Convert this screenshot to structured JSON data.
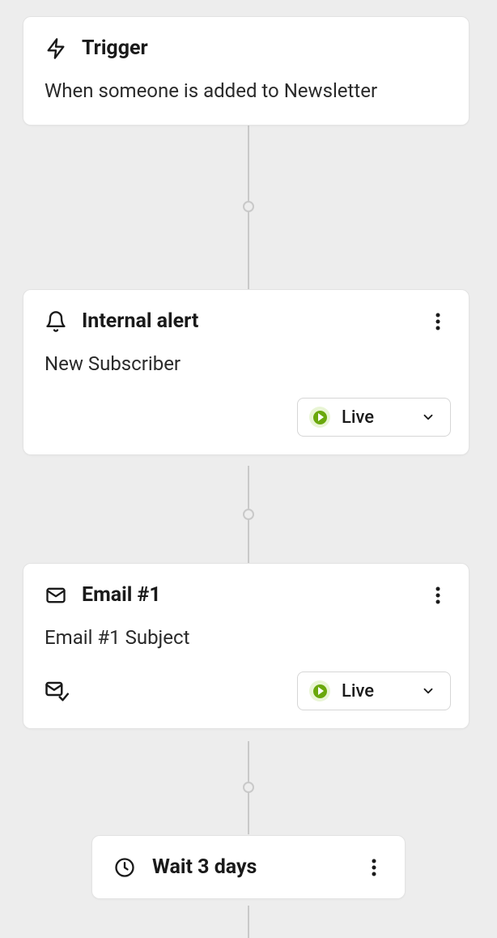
{
  "nodes": {
    "trigger": {
      "title": "Trigger",
      "description": "When someone is added to Newsletter"
    },
    "alert": {
      "title": "Internal alert",
      "description": "New Subscriber",
      "status": "Live"
    },
    "email1": {
      "title": "Email #1",
      "description": "Email #1 Subject",
      "status": "Live"
    },
    "wait": {
      "label": "Wait 3 days"
    }
  }
}
